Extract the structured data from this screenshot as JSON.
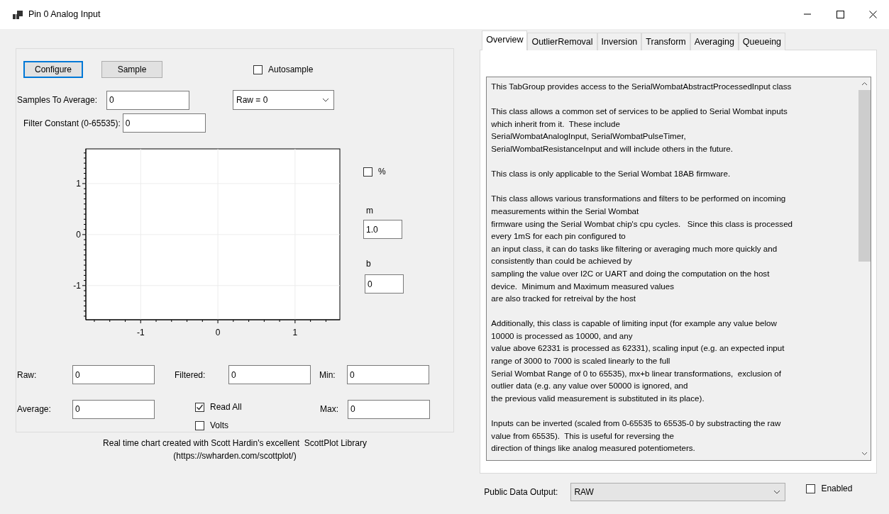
{
  "window": {
    "title": "Pin 0 Analog Input"
  },
  "buttons": [
    {
      "label": "Configure",
      "focused": true
    },
    {
      "label": "Sample",
      "focused": false
    }
  ],
  "autosample": {
    "label": "Autosample",
    "checked": false
  },
  "samples_to_average": {
    "label": "Samples To Average:",
    "value": "0"
  },
  "mode_select": {
    "value": "Raw = 0"
  },
  "filter_constant": {
    "label": "Filter Constant (0-65535):",
    "value": "0"
  },
  "chart": {
    "chart_data": {
      "type": "line",
      "grid": true,
      "xlim": [
        -1.71,
        1.58
      ],
      "ylim": [
        -1.67,
        1.68
      ],
      "xticks": [
        -1,
        0,
        1
      ],
      "yticks": [
        -1,
        0,
        1
      ]
    }
  },
  "transform": {
    "percent": {
      "label": "%",
      "checked": false
    },
    "m": {
      "label": "m",
      "value": "1.0"
    },
    "b": {
      "label": "b",
      "value": "0"
    }
  },
  "readings": [
    [
      {
        "label": "Raw:",
        "value": "0"
      },
      {
        "label": "Filtered:",
        "value": "0"
      },
      {
        "label": "Min:",
        "value": "0"
      }
    ],
    [
      {
        "label": "Average:",
        "value": "0"
      },
      {
        "label": "Max:",
        "value": "0"
      }
    ]
  ],
  "options": [
    {
      "label": "Read All",
      "checked": true
    },
    {
      "label": "Volts",
      "checked": false
    }
  ],
  "credit": [
    "Real time chart created with Scott Hardin's excellent  ScottPlot Library",
    "(https://swharden.com/scottplot/)"
  ],
  "tabs": [
    {
      "label": "Overview",
      "selected": true
    },
    {
      "label": "OutlierRemoval",
      "selected": false
    },
    {
      "label": "Inversion",
      "selected": false
    },
    {
      "label": "Transform",
      "selected": false
    },
    {
      "label": "Averaging",
      "selected": false
    },
    {
      "label": "Queueing",
      "selected": false
    }
  ],
  "overview": {
    "paragraphs": [
      [
        "This TabGroup provides access to the SerialWombatAbstractProcessedInput class"
      ],
      [
        "This class allows a common set of services to be applied to Serial Wombat inputs",
        "which inherit from it.  These include",
        "SerialWombatAnalogInput, SerialWombatPulseTimer,",
        "SerialWombatResistanceInput and will include others in the future."
      ],
      [
        "This class is only applicable to the Serial Wombat 18AB firmware."
      ],
      [
        "This class allows various transformations and filters to be performed on incoming",
        "measurements within the Serial Wombat",
        "firmware using the Serial Wombat chip's cpu cycles.   Since this class is processed",
        "every 1mS for each pin configured to",
        "an input class, it can do tasks like filtering or averaging much more quickly and",
        "consistently than could be achieved by",
        "sampling the value over I2C or UART and doing the computation on the host",
        "device.  Minimum and Maximum measured values",
        "are also tracked for retreival by the host"
      ],
      [
        "Additionally, this class is capable of limiting input (for example any value below",
        "10000 is processed as 10000, and any",
        "value above 62331 is processed as 62331), scaling input (e.g. an expected input",
        "range of 3000 to 7000 is scaled linearly to the full",
        "Serial Wombat Range of 0 to 65535), mx+b linear transformations,  exclusion of",
        "outlier data (e.g. any value over 50000 is ignored, and",
        "the previous valid measurement is substituted in its place)."
      ],
      [
        "Inputs can be inverted (scaled from 0-65535 to 65535-0 by substracting the raw",
        "value from 65535).  This is useful for reversing the",
        "direction of things like analog measured potentiometers."
      ]
    ]
  },
  "public_data_output": {
    "label": "Public Data Output:",
    "value": "RAW"
  },
  "enabled": {
    "label": "Enabled",
    "checked": false
  }
}
